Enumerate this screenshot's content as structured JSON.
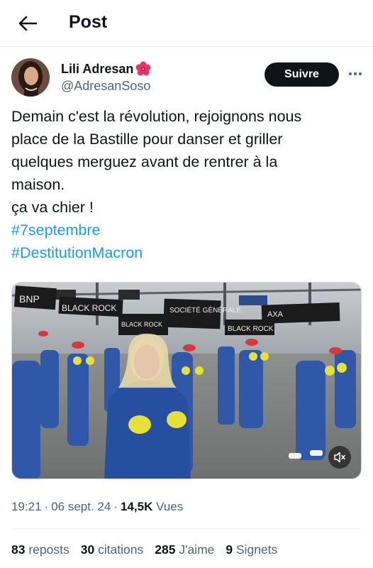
{
  "header": {
    "back_icon": "arrow-left-icon",
    "title": "Post"
  },
  "author": {
    "name": "Lili Adresan",
    "name_emoji": "hibiscus-flower-emoji",
    "handle": "@AdresanSoso",
    "follow_label": "Suivre"
  },
  "tweet": {
    "lines": [
      "Demain c'est la révolution, rejoignons nous",
      "place de la Bastille pour danser et griller",
      "quelques merguez avant de rentrer à la",
      "maison.",
      "ça va chier !"
    ],
    "hashtags": [
      "#7septembre",
      "#DestitutionMacron"
    ]
  },
  "media": {
    "type": "video",
    "signs": [
      "BNP",
      "BLACK ROCK",
      "SOCIÉTÉ GÉNÉRALE",
      "AXA",
      "BLACK ROCK",
      "BLACK ROCK"
    ],
    "mute_icon": "speaker-muted-icon"
  },
  "meta": {
    "time": "19:21",
    "date": "06 sept. 24",
    "views_count": "14,5K",
    "views_label": "Vues",
    "separator": "·"
  },
  "stats": {
    "reposts_count": "83",
    "reposts_label": "reposts",
    "quotes_count": "30",
    "quotes_label": "citations",
    "likes_count": "285",
    "likes_label": "J'aime",
    "bookmarks_count": "9",
    "bookmarks_label": "Signets"
  },
  "colors": {
    "text": "#0f1419",
    "secondary": "#536471",
    "link": "#1d9bf0",
    "follow_bg": "#0f1419"
  }
}
